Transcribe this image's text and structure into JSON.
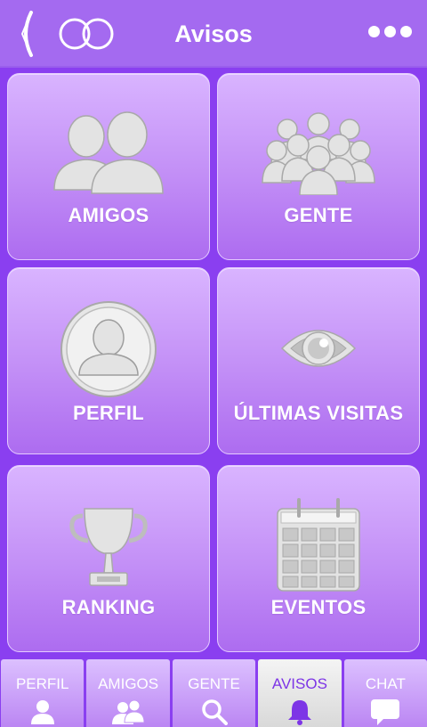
{
  "header": {
    "title": "Avisos",
    "back_icon": "back-chevron-icon",
    "logo": "infinity-logo",
    "menu_icon": "more-dots-icon"
  },
  "tiles": [
    {
      "label": "AMIGOS",
      "icon": "friends-icon"
    },
    {
      "label": "GENTE",
      "icon": "people-crowd-icon"
    },
    {
      "label": "PERFIL",
      "icon": "profile-icon"
    },
    {
      "label": "ÚLTIMAS VISITAS",
      "icon": "eye-icon"
    },
    {
      "label": "RANKING",
      "icon": "trophy-icon"
    },
    {
      "label": "EVENTOS",
      "icon": "calendar-icon"
    }
  ],
  "tabs": [
    {
      "label": "PERFIL",
      "icon": "person-icon",
      "active": false
    },
    {
      "label": "AMIGOS",
      "icon": "friends-small-icon",
      "active": false
    },
    {
      "label": "GENTE",
      "icon": "search-icon",
      "active": false
    },
    {
      "label": "AVISOS",
      "icon": "bell-icon",
      "active": true
    },
    {
      "label": "CHAT",
      "icon": "chat-bubble-icon",
      "active": false
    }
  ],
  "colors": {
    "background": "#8a3ff0",
    "header": "#a46af0",
    "tile_top": "#d9b4ff",
    "tile_bottom": "#ad6cf0",
    "active_tab": "#f4f4f4",
    "active_tab_text": "#7d35e6"
  }
}
